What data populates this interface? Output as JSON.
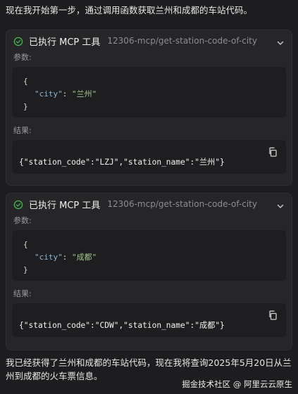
{
  "intro": {
    "text": "现在我开始第一步，通过调用函数获取兰州和成都的车站代码。"
  },
  "cards": [
    {
      "status_label": "已执行 MCP 工具",
      "tool_name": "12306-mcp/get-station-code-of-city",
      "params_label": "参数:",
      "params": {
        "open": "{",
        "key": "\"city\"",
        "colon": ": ",
        "value": "\"兰州\"",
        "close": "}"
      },
      "result_label": "结果:",
      "result": "{\"station_code\":\"LZJ\",\"station_name\":\"兰州\"}"
    },
    {
      "status_label": "已执行 MCP 工具",
      "tool_name": "12306-mcp/get-station-code-of-city",
      "params_label": "参数:",
      "params": {
        "open": "{",
        "key": "\"city\"",
        "colon": ": ",
        "value": "\"成都\"",
        "close": "}"
      },
      "result_label": "结果:",
      "result": "{\"station_code\":\"CDW\",\"station_name\":\"成都\"}"
    }
  ],
  "outro": {
    "text": "我已经获得了兰州和成都的车站代码，现在我将查询2025年5月20日从兰州到成都的火车票信息。"
  },
  "watermark": {
    "text": "掘金技术社区 @ 阿里云云原生"
  },
  "colors": {
    "background": "#1d1d1f",
    "card": "#262628",
    "code_bg": "#1e1e20",
    "success": "#3fb950"
  },
  "icons": {
    "status": "check-circle-icon",
    "toggle": "chevron-down-icon",
    "copy": "copy-icon"
  }
}
